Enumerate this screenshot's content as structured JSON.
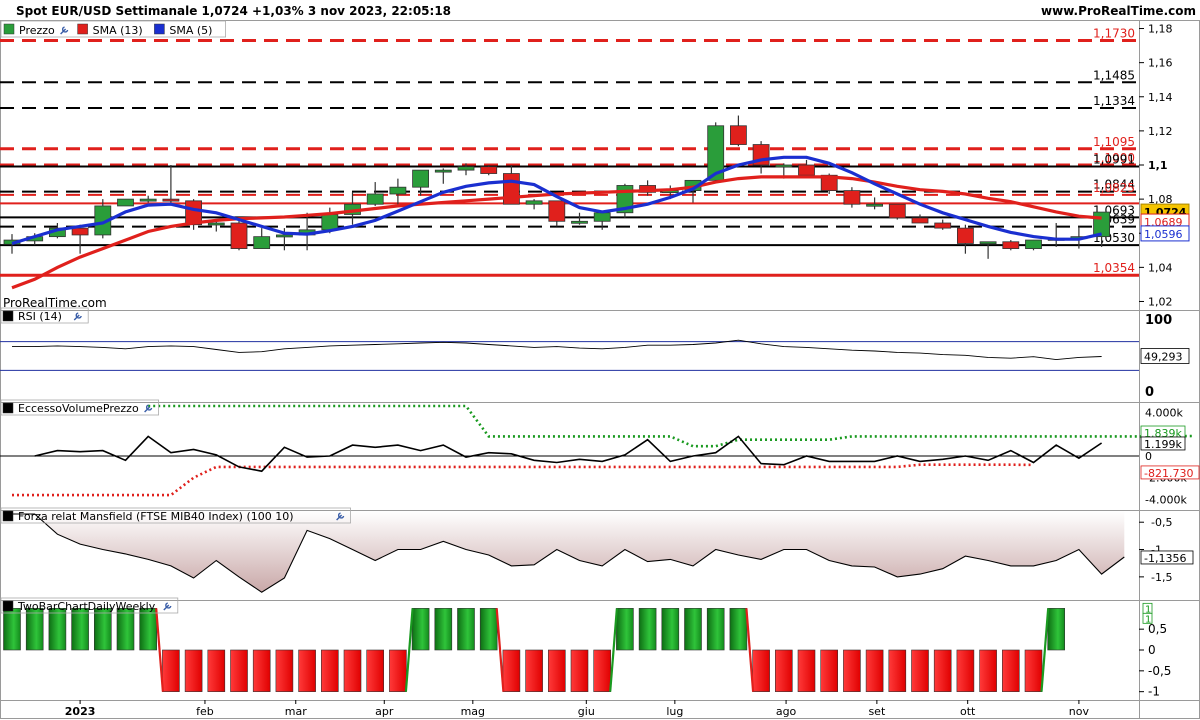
{
  "header": {
    "title": "Spot EUR/USD Settimanale 1,0724 +1,03% 3 nov 2023, 22:05:18",
    "site": "www.ProRealTime.com"
  },
  "colors": {
    "up": "#2a9d3a",
    "down": "#e0201c",
    "sma13": "#e0201c",
    "sma5": "#1a2fd0",
    "frame": "#9a9a9a",
    "mansfield_fill": "#c9a8a8"
  },
  "chart_data": [
    {
      "type": "candlestick",
      "panel": "price",
      "legend": [
        {
          "label": "Prezzo",
          "color": "#2a9d3a"
        },
        {
          "label": "SMA (13)",
          "color": "#e0201c"
        },
        {
          "label": "SMA (5)",
          "color": "#1a2fd0"
        }
      ],
      "watermark": "ProRealTime.com",
      "ylim": [
        1.015,
        1.185
      ],
      "yticks": [
        "1,18",
        "1,16",
        "1,14",
        "1,12",
        "1,1",
        "1,08",
        "1,06",
        "1,04",
        "1,02"
      ],
      "yticks_values": [
        1.18,
        1.16,
        1.14,
        1.12,
        1.1,
        1.08,
        1.06,
        1.04,
        1.02
      ],
      "x_labels": [
        "2023",
        "feb",
        "mar",
        "apr",
        "mag",
        "giu",
        "lug",
        "ago",
        "set",
        "ott",
        "nov"
      ],
      "x_label_index": [
        3,
        8.5,
        12.5,
        16.4,
        20.3,
        25.3,
        29.2,
        34.1,
        38.1,
        42.1,
        47
      ],
      "candles": [
        [
          1.0535,
          1.0595,
          1.048,
          1.056
        ],
        [
          1.0555,
          1.06,
          1.053,
          1.058
        ],
        [
          1.058,
          1.066,
          1.057,
          1.063
        ],
        [
          1.063,
          1.065,
          1.048,
          1.059
        ],
        [
          1.059,
          1.08,
          1.057,
          1.076
        ],
        [
          1.076,
          1.08,
          1.076,
          1.08
        ],
        [
          1.08,
          1.082,
          1.078,
          1.08
        ],
        [
          1.08,
          1.1,
          1.078,
          1.079
        ],
        [
          1.079,
          1.08,
          1.062,
          1.065
        ],
        [
          1.065,
          1.068,
          1.061,
          1.066
        ],
        [
          1.066,
          1.068,
          1.05,
          1.051
        ],
        [
          1.051,
          1.063,
          1.051,
          1.058
        ],
        [
          1.058,
          1.063,
          1.05,
          1.059
        ],
        [
          1.059,
          1.072,
          1.05,
          1.062
        ],
        [
          1.062,
          1.075,
          1.06,
          1.071
        ],
        [
          1.071,
          1.084,
          1.065,
          1.077
        ],
        [
          1.077,
          1.09,
          1.076,
          1.083
        ],
        [
          1.083,
          1.092,
          1.076,
          1.087
        ],
        [
          1.087,
          1.096,
          1.082,
          1.097
        ],
        [
          1.097,
          1.098,
          1.089,
          1.097
        ],
        [
          1.097,
          1.101,
          1.094,
          1.099
        ],
        [
          1.099,
          1.1,
          1.094,
          1.095
        ],
        [
          1.095,
          1.1,
          1.078,
          1.077
        ],
        [
          1.077,
          1.08,
          1.074,
          1.079
        ],
        [
          1.079,
          1.079,
          1.064,
          1.067
        ],
        [
          1.067,
          1.072,
          1.065,
          1.067
        ],
        [
          1.067,
          1.072,
          1.062,
          1.072
        ],
        [
          1.072,
          1.089,
          1.069,
          1.088
        ],
        [
          1.088,
          1.091,
          1.082,
          1.084
        ],
        [
          1.084,
          1.088,
          1.08,
          1.085
        ],
        [
          1.085,
          1.088,
          1.078,
          1.091
        ],
        [
          1.091,
          1.125,
          1.09,
          1.123
        ],
        [
          1.123,
          1.129,
          1.111,
          1.112
        ],
        [
          1.112,
          1.114,
          1.095,
          1.1
        ],
        [
          1.1,
          1.101,
          1.092,
          1.1
        ],
        [
          1.1,
          1.103,
          1.094,
          1.094
        ],
        [
          1.094,
          1.095,
          1.083,
          1.085
        ],
        [
          1.085,
          1.087,
          1.075,
          1.077
        ],
        [
          1.077,
          1.081,
          1.074,
          1.077
        ],
        [
          1.077,
          1.077,
          1.068,
          1.069
        ],
        [
          1.069,
          1.071,
          1.066,
          1.066
        ],
        [
          1.066,
          1.068,
          1.062,
          1.063
        ],
        [
          1.063,
          1.065,
          1.048,
          1.054
        ],
        [
          1.054,
          1.055,
          1.045,
          1.055
        ],
        [
          1.055,
          1.056,
          1.05,
          1.051
        ],
        [
          1.051,
          1.056,
          1.05,
          1.056
        ],
        [
          1.056,
          1.066,
          1.052,
          1.057
        ],
        [
          1.057,
          1.064,
          1.051,
          1.058
        ],
        [
          1.058,
          1.07,
          1.052,
          1.0724
        ]
      ],
      "sma13": [
        1.028,
        1.033,
        1.04,
        1.046,
        1.051,
        1.056,
        1.061,
        1.064,
        1.066,
        1.0675,
        1.0685,
        1.069,
        1.0695,
        1.0705,
        1.0715,
        1.073,
        1.0745,
        1.076,
        1.077,
        1.078,
        1.079,
        1.08,
        1.081,
        1.082,
        1.083,
        1.0835,
        1.084,
        1.0845,
        1.085,
        1.0855,
        1.087,
        1.09,
        1.092,
        1.093,
        1.093,
        1.093,
        1.093,
        1.092,
        1.09,
        1.0875,
        1.0855,
        1.0845,
        1.083,
        1.0805,
        1.0785,
        1.0755,
        1.0725,
        1.07,
        1.0689
      ],
      "sma5": [
        1.054,
        1.058,
        1.062,
        1.064,
        1.066,
        1.0725,
        1.0765,
        1.077,
        1.074,
        1.072,
        1.068,
        1.064,
        1.06,
        1.0595,
        1.0615,
        1.064,
        1.0675,
        1.073,
        1.0785,
        1.084,
        1.0875,
        1.0895,
        1.0905,
        1.0885,
        1.0815,
        1.075,
        1.0725,
        1.0745,
        1.077,
        1.081,
        1.086,
        1.095,
        1.1,
        1.103,
        1.1045,
        1.1045,
        1.101,
        1.0955,
        1.089,
        1.083,
        1.077,
        1.072,
        1.068,
        1.064,
        1.0605,
        1.058,
        1.0565,
        1.0565,
        1.0596
      ],
      "hlines": [
        {
          "value": 1.173,
          "label": "1,1730",
          "color": "#e0201c",
          "style": "dashed",
          "lw": 3
        },
        {
          "value": 1.1485,
          "label": "1,1485",
          "color": "#000000",
          "style": "dashed",
          "lw": 2
        },
        {
          "value": 1.1334,
          "label": "1,1334",
          "color": "#000000",
          "style": "dashed",
          "lw": 2
        },
        {
          "value": 1.1095,
          "label": "1,1095",
          "color": "#e0201c",
          "style": "dashed",
          "lw": 3
        },
        {
          "value": 1.1,
          "label": "1,1000",
          "color": "#e0201c",
          "style": "dashed",
          "lw": 3
        },
        {
          "value": 1.0991,
          "label": "1,0991",
          "color": "#000000",
          "style": "solid",
          "lw": 2
        },
        {
          "value": 1.0844,
          "label": "1,0844",
          "color": "#000000",
          "style": "dashed",
          "lw": 2
        },
        {
          "value": 1.0825,
          "label": "1,0825",
          "color": "#e0201c",
          "style": "dashed",
          "lw": 2
        },
        {
          "value": 1.0775,
          "label": "",
          "color": "#e0201c",
          "style": "solid",
          "lw": 2
        },
        {
          "value": 1.0693,
          "label": "1,0693",
          "color": "#000000",
          "style": "solid",
          "lw": 2
        },
        {
          "value": 1.0639,
          "label": "1,0639",
          "color": "#000000",
          "style": "dashed",
          "lw": 2
        },
        {
          "value": 1.053,
          "label": "1,0530",
          "color": "#000000",
          "style": "solid",
          "lw": 2
        },
        {
          "value": 1.0354,
          "label": "1,0354",
          "color": "#e0201c",
          "style": "solid",
          "lw": 3
        }
      ],
      "badges": [
        {
          "value": 1.0724,
          "label": "1,0724",
          "kind": "price"
        },
        {
          "value": 1.0689,
          "label": "1,0689",
          "kind": "sma13"
        },
        {
          "value": 1.0596,
          "label": "1,0596",
          "kind": "sma5"
        }
      ]
    },
    {
      "type": "line",
      "panel": "rsi",
      "title": "RSI (14)",
      "ylim": [
        0,
        100
      ],
      "yticks": [
        "100",
        "0"
      ],
      "band": [
        70,
        30
      ],
      "last": "49,293",
      "values": [
        63,
        63,
        64,
        63,
        62,
        60,
        63,
        64,
        63,
        59,
        55,
        56,
        60,
        62,
        64,
        65,
        66,
        67,
        68,
        69,
        68,
        66,
        64,
        62,
        63,
        61,
        60,
        62,
        65,
        65,
        66,
        68,
        72,
        67,
        63,
        62,
        60,
        58,
        57,
        55,
        54,
        52,
        51,
        48,
        47,
        49,
        45,
        48,
        49.3
      ]
    },
    {
      "type": "line",
      "panel": "eccesso",
      "title": "EccessoVolumePrezzo",
      "ylim": [
        -4600,
        4600
      ],
      "yticks": [
        "4.000k",
        "2.000k",
        "0",
        "-2.000k",
        "-4.000k"
      ],
      "yticks_values": [
        4000,
        2000,
        0,
        -2000,
        -4000
      ],
      "upper_last": "1.839k",
      "value_last": "1.199k",
      "lower_last": "-821.730",
      "line": [
        0,
        500,
        400,
        500,
        -400,
        1800,
        300,
        600,
        100,
        -1000,
        -1400,
        800,
        -100,
        0,
        1000,
        800,
        1000,
        500,
        1000,
        -100,
        300,
        200,
        -400,
        -600,
        -300,
        -500,
        100,
        1500,
        -500,
        0,
        300,
        1800,
        -700,
        -800,
        0,
        -500,
        -500,
        -500,
        0,
        -500,
        -300,
        0,
        -400,
        500,
        -600,
        1000,
        -200,
        1199
      ],
      "line_start": 1,
      "upper": [
        4600,
        4600,
        4600,
        4600,
        4600,
        4600,
        4600,
        4600,
        4600,
        4600,
        4600,
        4600,
        4600,
        4600,
        4600,
        1800,
        1800,
        1800,
        1800,
        1800,
        1800,
        1800,
        1800,
        1800,
        900,
        900,
        1500,
        1500,
        1500,
        1500,
        1500,
        1800,
        1800,
        1800,
        1800,
        1800,
        1800,
        1800,
        1800,
        1800,
        1800,
        1800,
        1800,
        1800,
        1800,
        1800,
        1839
      ],
      "upper_start": 6,
      "lower": [
        -3600,
        -3600,
        -3600,
        -3600,
        -3600,
        -3600,
        -3600,
        -3600,
        -2000,
        -1000,
        -1000,
        -1000,
        -1000,
        -1000,
        -1000,
        -1000,
        -1000,
        -1000,
        -1000,
        -1000,
        -1000,
        -1000,
        -1000,
        -1000,
        -1000,
        -1000,
        -1000,
        -1000,
        -1000,
        -1000,
        -1000,
        -1000,
        -1000,
        -1000,
        -1000,
        -1000,
        -1000,
        -1000,
        -1000,
        -1000,
        -800,
        -800,
        -800,
        -800,
        -800,
        -822
      ]
    },
    {
      "type": "area",
      "panel": "mansfield",
      "title": "Forza relat Mansfield (FTSE MIB40 Index) (100 10)",
      "ylim": [
        -1.85,
        -0.35
      ],
      "yticks": [
        "-0,5",
        "-1",
        "-1,5"
      ],
      "yticks_values": [
        -0.5,
        -1.0,
        -1.5
      ],
      "last": "-1,1356",
      "values": [
        -0.35,
        -0.35,
        -0.72,
        -0.9,
        -1.0,
        -1.08,
        -1.18,
        -1.3,
        -1.52,
        -1.2,
        -1.5,
        -1.78,
        -1.52,
        -0.65,
        -0.8,
        -1.0,
        -1.2,
        -1.0,
        -1.0,
        -0.85,
        -1.0,
        -1.1,
        -1.3,
        -1.28,
        -1.0,
        -1.2,
        -1.3,
        -1.0,
        -1.22,
        -1.18,
        -1.3,
        -1.0,
        -1.1,
        -1.18,
        -1.0,
        -1.0,
        -1.2,
        -1.3,
        -1.32,
        -1.5,
        -1.45,
        -1.35,
        -1.12,
        -1.2,
        -1.3,
        -1.3,
        -1.2,
        -1.0,
        -1.45,
        -1.136
      ],
      "values_start": 0
    },
    {
      "type": "bar",
      "panel": "twobar",
      "title": "TwoBarChartDailyWeekly",
      "ylim": [
        -1.2,
        1.2
      ],
      "yticks": [
        "0,5",
        "0",
        "-0,5",
        "-1"
      ],
      "yticks_values": [
        0.5,
        0,
        -0.5,
        -1
      ],
      "last_labels": [
        "1",
        "1"
      ],
      "values": [
        1,
        1,
        1,
        1,
        1,
        1,
        1,
        -1,
        -1,
        -1,
        -1,
        -1,
        -1,
        -1,
        -1,
        -1,
        -1,
        -1,
        1,
        1,
        1,
        1,
        -1,
        -1,
        -1,
        -1,
        -1,
        1,
        1,
        1,
        1,
        1,
        1,
        -1,
        -1,
        -1,
        -1,
        -1,
        -1,
        -1,
        -1,
        -1,
        -1,
        -1,
        -1,
        -1,
        1
      ]
    }
  ]
}
